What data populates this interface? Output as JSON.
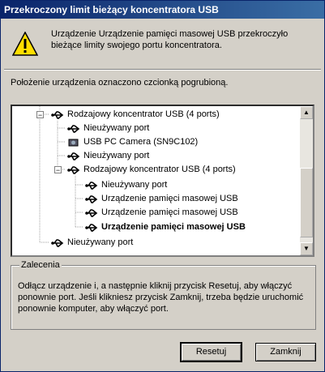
{
  "window": {
    "title": "Przekroczony limit bieżący koncentratora USB"
  },
  "message": "Urządzenie Urządzenie pamięci masowej USB przekroczyło bieżące limity swojego portu koncentratora.",
  "location_note": "Położenie urządzenia oznaczono czcionką pogrubioną.",
  "tree": {
    "items": [
      {
        "label": "Rodzajowy koncentrator USB (4 ports)",
        "icon": "usb-hub-icon",
        "bold": false
      },
      {
        "label": "Nieużywany port",
        "icon": "usb-port-icon",
        "bold": false
      },
      {
        "label": "USB PC Camera (SN9C102)",
        "icon": "usb-camera-icon",
        "bold": false
      },
      {
        "label": "Nieużywany port",
        "icon": "usb-port-icon",
        "bold": false
      },
      {
        "label": "Rodzajowy koncentrator USB (4 ports)",
        "icon": "usb-hub-icon",
        "bold": false
      },
      {
        "label": "Nieużywany port",
        "icon": "usb-port-icon",
        "bold": false
      },
      {
        "label": "Urządzenie pamięci masowej USB",
        "icon": "usb-storage-icon",
        "bold": false
      },
      {
        "label": "Urządzenie pamięci masowej USB",
        "icon": "usb-storage-icon",
        "bold": false
      },
      {
        "label": "Urządzenie pamięci masowej USB",
        "icon": "usb-storage-icon",
        "bold": true
      },
      {
        "label": "Nieużywany port",
        "icon": "usb-port-icon",
        "bold": false
      }
    ]
  },
  "recommendation": {
    "title": "Zalecenia",
    "text": "Odłącz urządzenie i, a następnie kliknij przycisk Resetuj, aby włączyć ponownie port. Jeśli klikniesz przycisk Zamknij, trzeba będzie uruchomić ponownie komputer, aby włączyć port."
  },
  "buttons": {
    "reset": "Resetuj",
    "close": "Zamknij"
  }
}
